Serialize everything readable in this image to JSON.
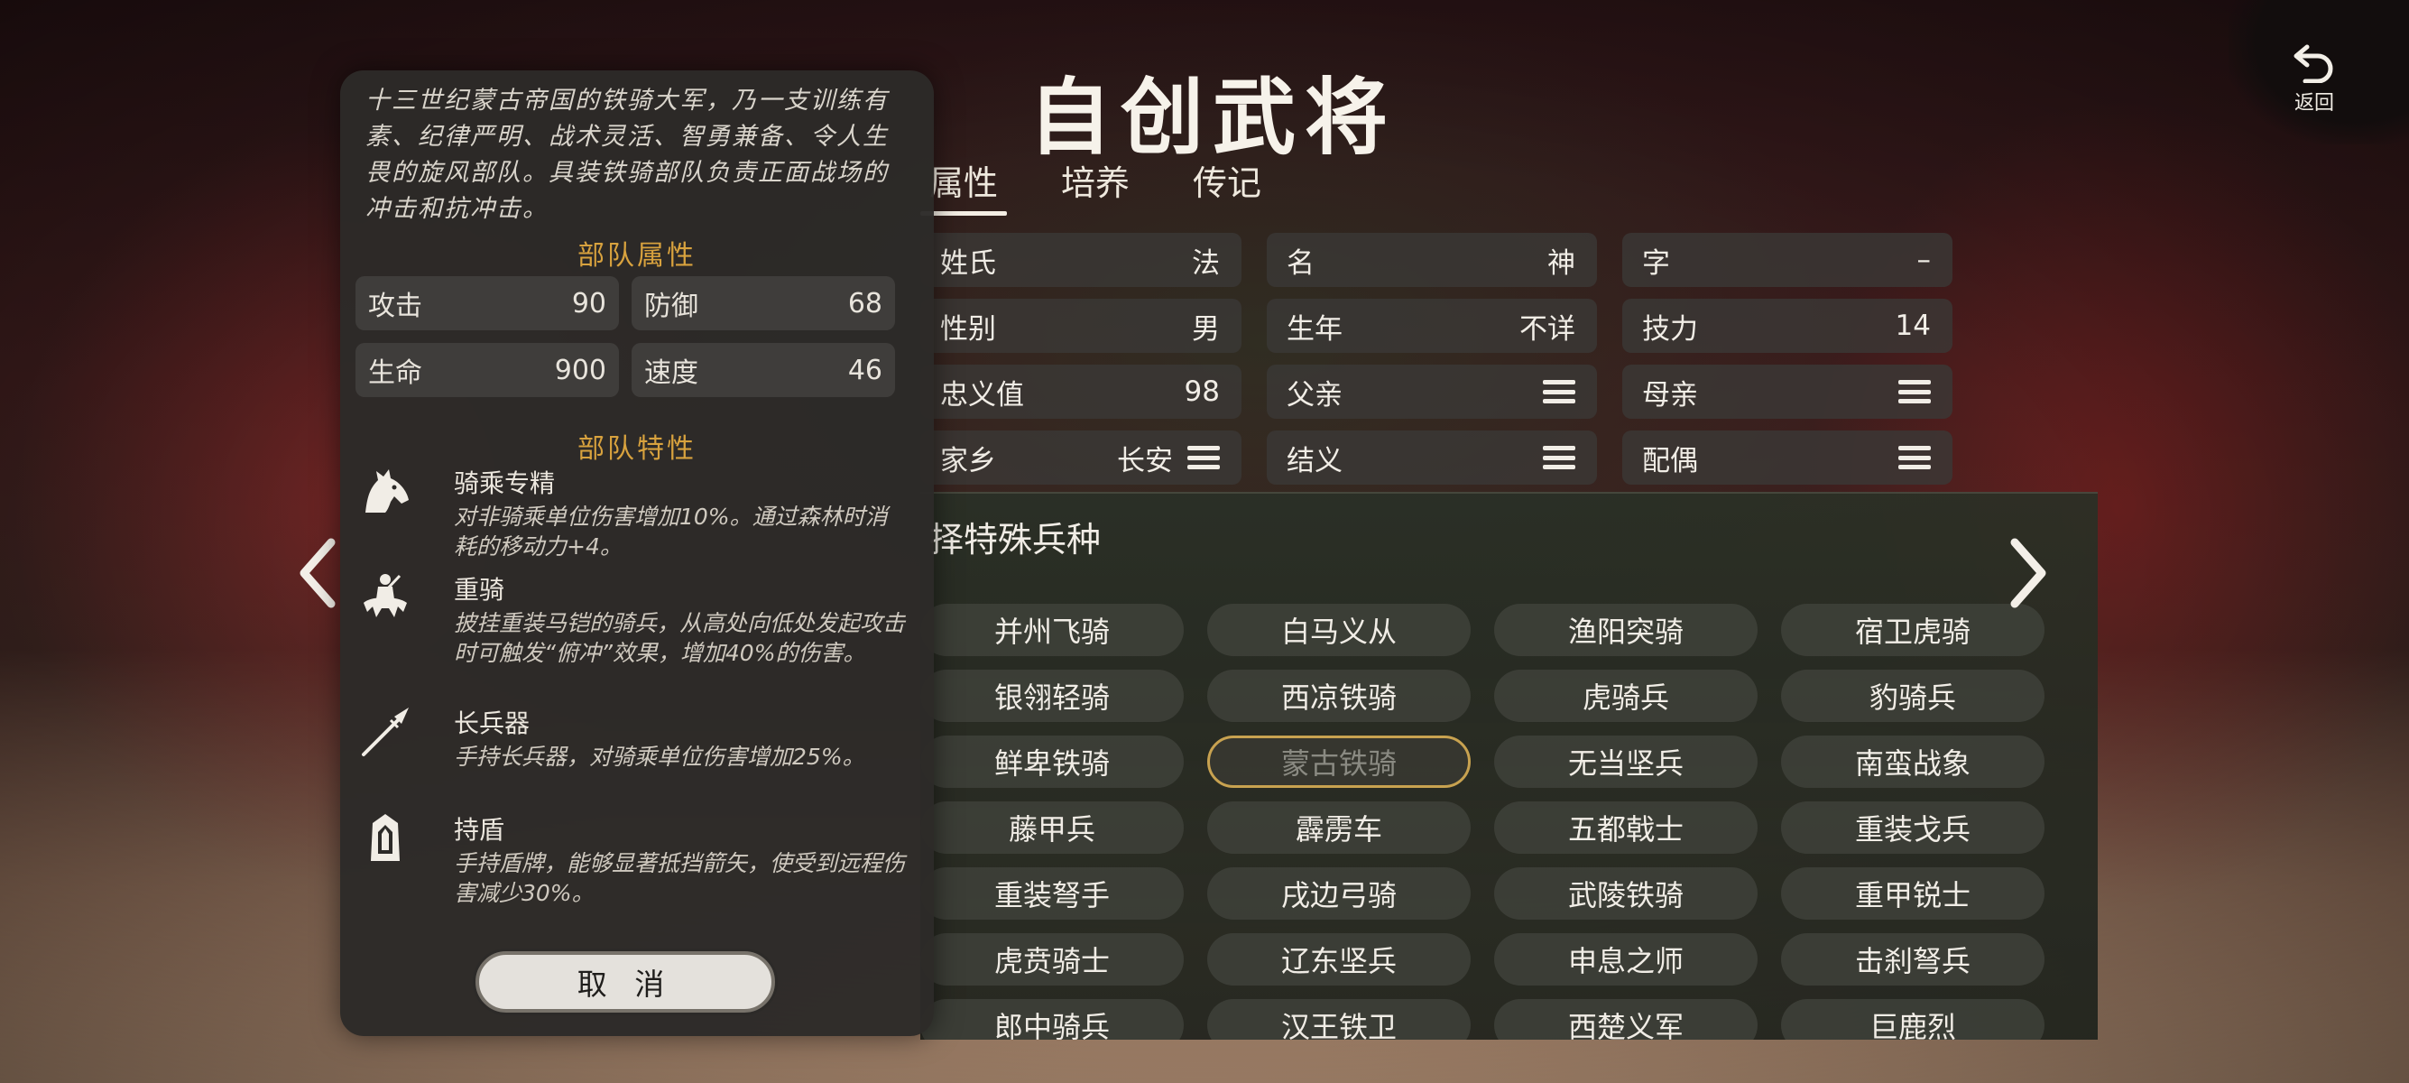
{
  "header": {
    "title": "自创武将",
    "back_label": "返回"
  },
  "tabs": [
    {
      "label": "属性"
    },
    {
      "label": "培养"
    },
    {
      "label": "传记"
    }
  ],
  "attributes": {
    "surname": {
      "label": "姓氏",
      "value": "法"
    },
    "given_name": {
      "label": "名",
      "value": "神"
    },
    "courtesy": {
      "label": "字",
      "value": "–"
    },
    "gender": {
      "label": "性别",
      "value": "男"
    },
    "birth_year": {
      "label": "生年",
      "value": "不详"
    },
    "skill": {
      "label": "技力",
      "value": "14"
    },
    "loyalty": {
      "label": "忠义值",
      "value": "98"
    },
    "father": {
      "label": "父亲"
    },
    "mother": {
      "label": "母亲"
    },
    "hometown": {
      "label": "家乡",
      "value": "长安"
    },
    "sworn": {
      "label": "结义"
    },
    "spouse": {
      "label": "配偶"
    }
  },
  "selection": {
    "title": "择特殊兵种",
    "units": [
      "并州飞骑",
      "白马义从",
      "渔阳突骑",
      "宿卫虎骑",
      "银翎轻骑",
      "西凉铁骑",
      "虎骑兵",
      "豹骑兵",
      "鲜卑铁骑",
      "蒙古铁骑",
      "无当坚兵",
      "南蛮战象",
      "藤甲兵",
      "霹雳车",
      "五都戟士",
      "重装戈兵",
      "重装弩手",
      "戌边弓骑",
      "武陵铁骑",
      "重甲锐士",
      "虎贲骑士",
      "辽东坚兵",
      "申息之师",
      "击刹弩兵",
      "郎中骑兵",
      "汉王铁卫",
      "西楚义军",
      "巨鹿烈"
    ],
    "selected_unit": "蒙古铁骑"
  },
  "info_panel": {
    "description": "十三世纪蒙古帝国的铁骑大军，乃一支训练有素、纪律严明、战术灵活、智勇兼备、令人生畏的旋风部队。具装铁骑部队负责正面战场的冲击和抗冲击。",
    "stats_title": "部队属性",
    "stats": [
      {
        "label": "攻击",
        "value": "90"
      },
      {
        "label": "防御",
        "value": "68"
      },
      {
        "label": "生命",
        "value": "900"
      },
      {
        "label": "速度",
        "value": "46"
      }
    ],
    "traits_title": "部队特性",
    "traits": [
      {
        "icon": "horse-head-icon",
        "name": "骑乘专精",
        "desc": "对非骑乘单位伤害增加10%。通过森林时消耗的移动力+4。"
      },
      {
        "icon": "armored-rider-icon",
        "name": "重骑",
        "desc": "披挂重装马铠的骑兵，从高处向低处发起攻击时可触发“俯冲”效果，增加40%的伤害。"
      },
      {
        "icon": "spear-icon",
        "name": "长兵器",
        "desc": "手持长兵器，对骑乘单位伤害增加25%。"
      },
      {
        "icon": "shield-icon",
        "name": "持盾",
        "desc": "手持盾牌，能够显著抵挡箭矢，使受到远程伤害减少30%。"
      }
    ],
    "cancel_label": "取 消"
  },
  "colors": {
    "accent_gold": "#d8a23e",
    "selected_border": "#c8a250",
    "panel_bg": "#2c2a28"
  }
}
